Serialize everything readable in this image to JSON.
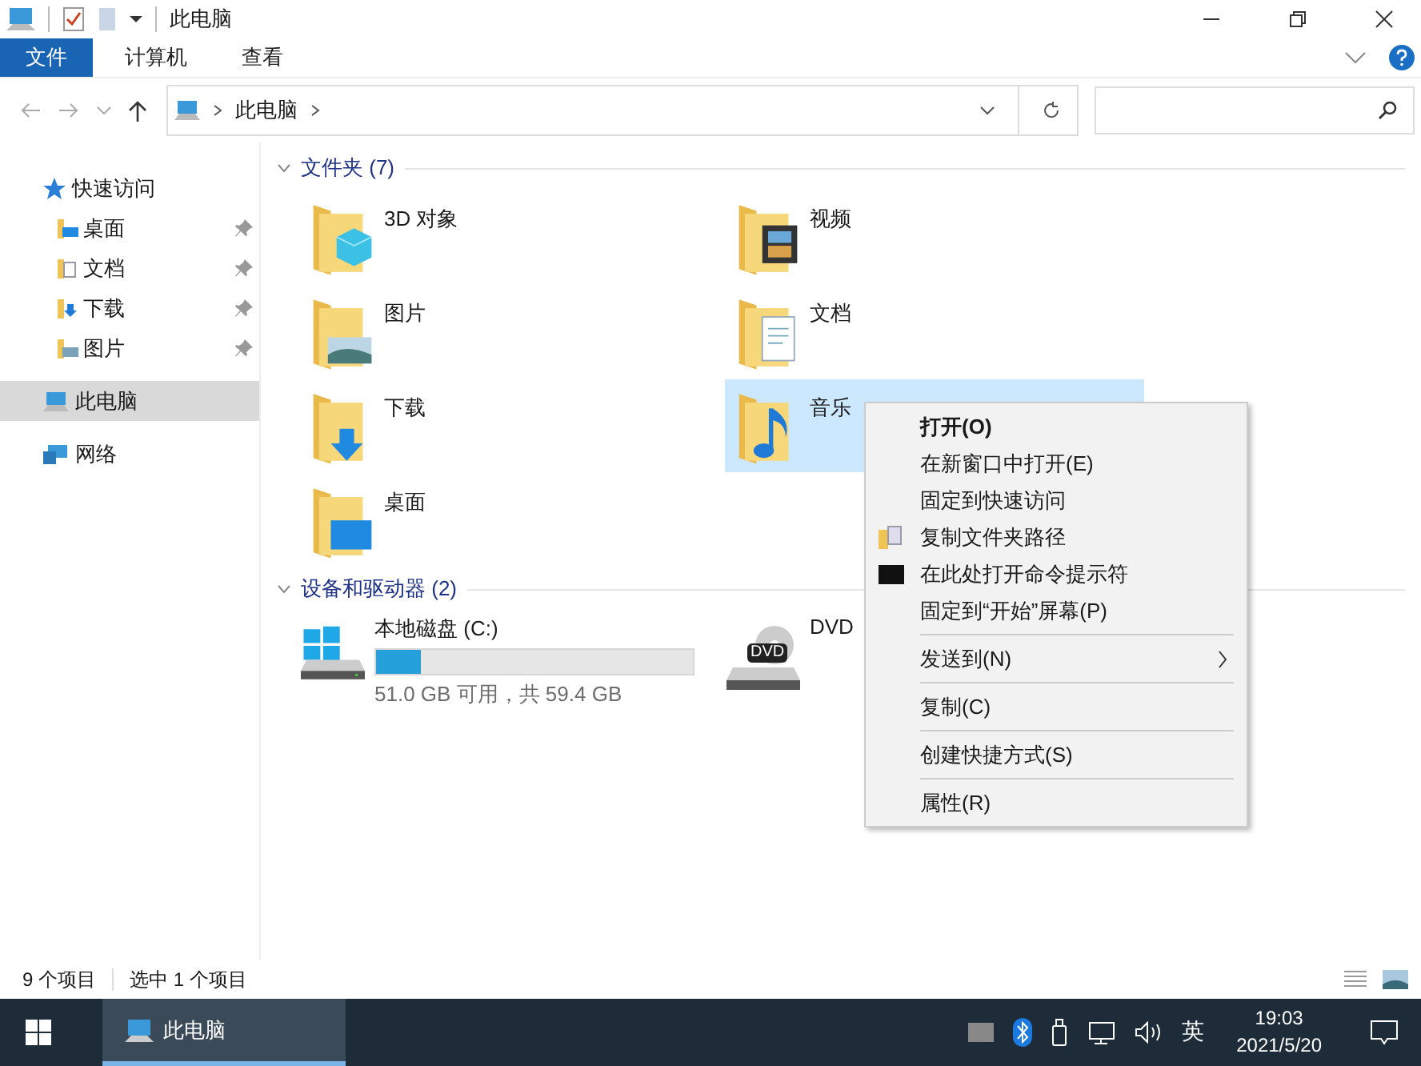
{
  "window": {
    "title": "此电脑"
  },
  "ribbon_tabs": [
    {
      "label": "文件",
      "kind": "file"
    },
    {
      "label": "计算机",
      "kind": "tab"
    },
    {
      "label": "查看",
      "kind": "tab"
    }
  ],
  "address_bar": {
    "path": "此电脑"
  },
  "navigation": [
    {
      "label": "快速访问",
      "kind": "star",
      "selected": false,
      "children": [
        {
          "label": "桌面",
          "kind": "desktop",
          "pinned": true
        },
        {
          "label": "文档",
          "kind": "doc",
          "pinned": true
        },
        {
          "label": "下载",
          "kind": "download",
          "pinned": true
        },
        {
          "label": "图片",
          "kind": "picture",
          "pinned": true
        }
      ]
    },
    {
      "label": "此电脑",
      "kind": "pc",
      "selected": true
    },
    {
      "label": "网络",
      "kind": "network",
      "selected": false
    }
  ],
  "folders_group": {
    "title": "文件夹 (7)",
    "items": [
      {
        "label": "3D 对象",
        "kind": "cube",
        "selected": false
      },
      {
        "label": "视频",
        "kind": "film",
        "selected": false
      },
      {
        "label": "图片",
        "kind": "picture",
        "selected": false
      },
      {
        "label": "文档",
        "kind": "doc",
        "selected": false
      },
      {
        "label": "下载",
        "kind": "download",
        "selected": false
      },
      {
        "label": "音乐",
        "kind": "music",
        "selected": true
      },
      {
        "label": "桌面",
        "kind": "desktop",
        "selected": false
      }
    ]
  },
  "drives_group": {
    "title": "设备和驱动器 (2)",
    "items": [
      {
        "label": "本地磁盘 (C:)",
        "kind": "disk",
        "level": 0.14,
        "free_text": "51.0 GB 可用，共 59.4 GB"
      },
      {
        "label": "DVD",
        "kind": "dvd",
        "icon_text": "DVD"
      }
    ]
  },
  "context_menu": [
    {
      "label": "打开(O)",
      "bold": true,
      "kind": "plain",
      "separator_before": false,
      "submenu": false
    },
    {
      "label": "在新窗口中打开(E)",
      "bold": false,
      "kind": "plain",
      "separator_before": false,
      "submenu": false
    },
    {
      "label": "固定到快速访问",
      "bold": false,
      "kind": "plain",
      "separator_before": false,
      "submenu": false
    },
    {
      "label": "复制文件夹路径",
      "bold": false,
      "kind": "folder",
      "separator_before": false,
      "submenu": false
    },
    {
      "label": "在此处打开命令提示符",
      "bold": false,
      "kind": "console",
      "separator_before": false,
      "submenu": false
    },
    {
      "label": "固定到“开始”屏幕(P)",
      "bold": false,
      "kind": "plain",
      "separator_before": false,
      "submenu": false
    },
    {
      "label": "发送到(N)",
      "bold": false,
      "kind": "plain",
      "separator_before": true,
      "submenu": true
    },
    {
      "label": "复制(C)",
      "bold": false,
      "kind": "plain",
      "separator_before": true,
      "submenu": false
    },
    {
      "label": "创建快捷方式(S)",
      "bold": false,
      "kind": "plain",
      "separator_before": true,
      "submenu": false
    },
    {
      "label": "属性(R)",
      "bold": false,
      "kind": "plain",
      "separator_before": true,
      "submenu": false
    }
  ],
  "status_bar": {
    "item_count": "9 个项目",
    "selection": "选中 1 个项目"
  },
  "taskbar": {
    "app": "此电脑",
    "input_method": "英",
    "time": "19:03",
    "date": "2021/5/20"
  }
}
